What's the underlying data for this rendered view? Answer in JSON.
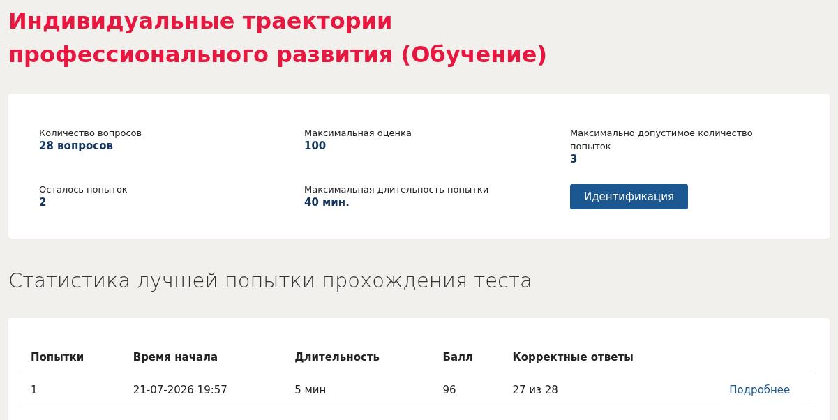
{
  "page_title": "Индивидуальные траектории профессионального развития (Обучение)",
  "info": [
    {
      "kind": "stat",
      "label": "Количество вопросов",
      "value": "28 вопросов"
    },
    {
      "kind": "stat",
      "label": "Максимальная оценка",
      "value": "100"
    },
    {
      "kind": "stat",
      "label": "Максимально допустимое количество попыток",
      "value": "3"
    },
    {
      "kind": "stat",
      "label": "Осталось попыток",
      "value": "2"
    },
    {
      "kind": "stat",
      "label": "Максимальная длительность попытки",
      "value": "40 мин."
    },
    {
      "kind": "button",
      "label": "Идентификация"
    }
  ],
  "stats_heading": "Статистика лучшей попытки прохождения теста",
  "table": {
    "columns": [
      "Попытки",
      "Время начала",
      "Длительность",
      "Балл",
      "Корректные ответы"
    ],
    "rows": [
      {
        "cells": [
          "1",
          "21-07-2026 19:57",
          "5 мин",
          "96",
          "27 из 28"
        ],
        "link": "Подробнее"
      }
    ]
  }
}
